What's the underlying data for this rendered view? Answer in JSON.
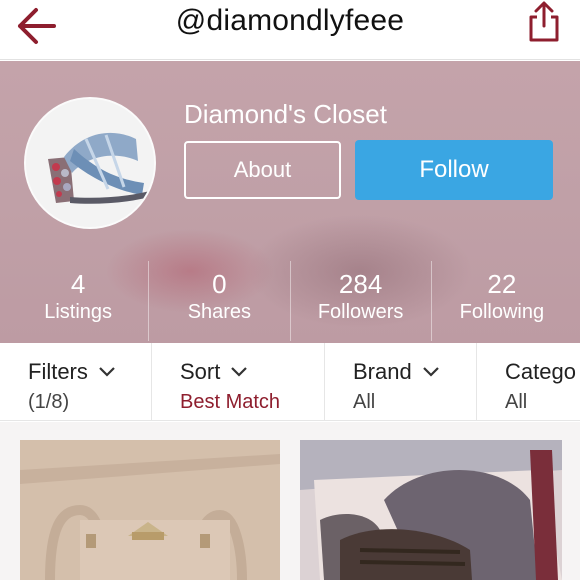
{
  "header": {
    "username": "@diamondlyfeee",
    "back_icon": "back-arrow-icon",
    "share_icon": "share-icon",
    "accent_color": "#8e1e2e"
  },
  "profile": {
    "closet_name": "Diamond's Closet",
    "about_label": "About",
    "follow_label": "Follow",
    "follow_color": "#3aa6e3",
    "stats": [
      {
        "value": "4",
        "label": "Listings"
      },
      {
        "value": "0",
        "label": "Shares"
      },
      {
        "value": "284",
        "label": "Followers"
      },
      {
        "value": "22",
        "label": "Following"
      }
    ]
  },
  "filters": [
    {
      "title": "Filters",
      "value": "(1/8)"
    },
    {
      "title": "Sort",
      "value": "Best Match"
    },
    {
      "title": "Brand",
      "value": "All"
    },
    {
      "title": "Catego",
      "value": "All"
    }
  ]
}
